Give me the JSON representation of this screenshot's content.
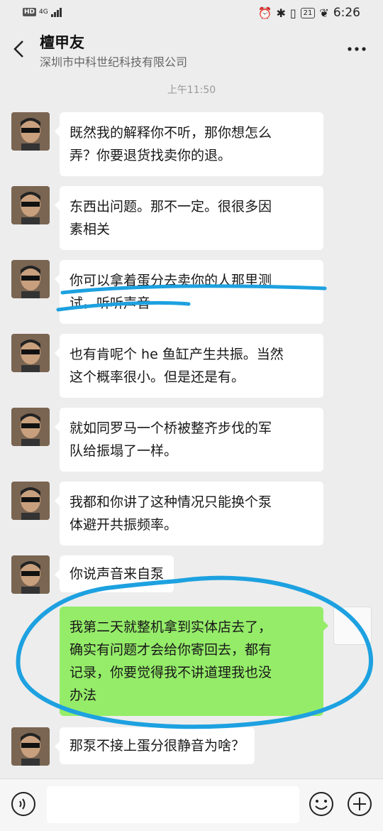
{
  "status": {
    "left": "HD 4G",
    "battery": "21",
    "time": "6:26"
  },
  "header": {
    "title": "檀甲友",
    "subtitle": "深圳市中科世纪科技有限公司"
  },
  "timestamp": "上午11:50",
  "messages": [
    {
      "text1": "既然我的解释你不听，那你想怎么",
      "text2": "弄？你要退货找卖你的退。"
    },
    {
      "text1": "东西出问题。那不一定。很很多因",
      "text2": "素相关"
    },
    {
      "text1": "你可以拿着蛋分去卖你的人那里测",
      "text2": "试。听听声音"
    },
    {
      "text1": "也有肯呢个 he 鱼缸产生共振。当然",
      "text2": "这个概率很小。但是还是有。"
    },
    {
      "text1": "就如同罗马一个桥被整齐步伐的军",
      "text2": "队给振塌了一样。"
    },
    {
      "text1": "我都和你讲了这种情况只能换个泵",
      "text2": "体避开共振频率。"
    },
    {
      "text1": "你说声音来自泵"
    },
    {
      "text1": "我第二天就整机拿到实体店去了，",
      "text2": "确实有问题才会给你寄回去，都有",
      "text3": "记录，你要觉得我不讲道理我也没",
      "text4": "办法"
    },
    {
      "text1": "那泵不接上蛋分很静音为啥？"
    }
  ],
  "colors": {
    "background": "#ededed",
    "bubble_other": "#ffffff",
    "bubble_me": "#95ec69",
    "annotation": "#1da1e0"
  },
  "icons": [
    "back-arrow-icon",
    "more-icon",
    "voice-icon",
    "emoji-icon",
    "plus-icon"
  ]
}
